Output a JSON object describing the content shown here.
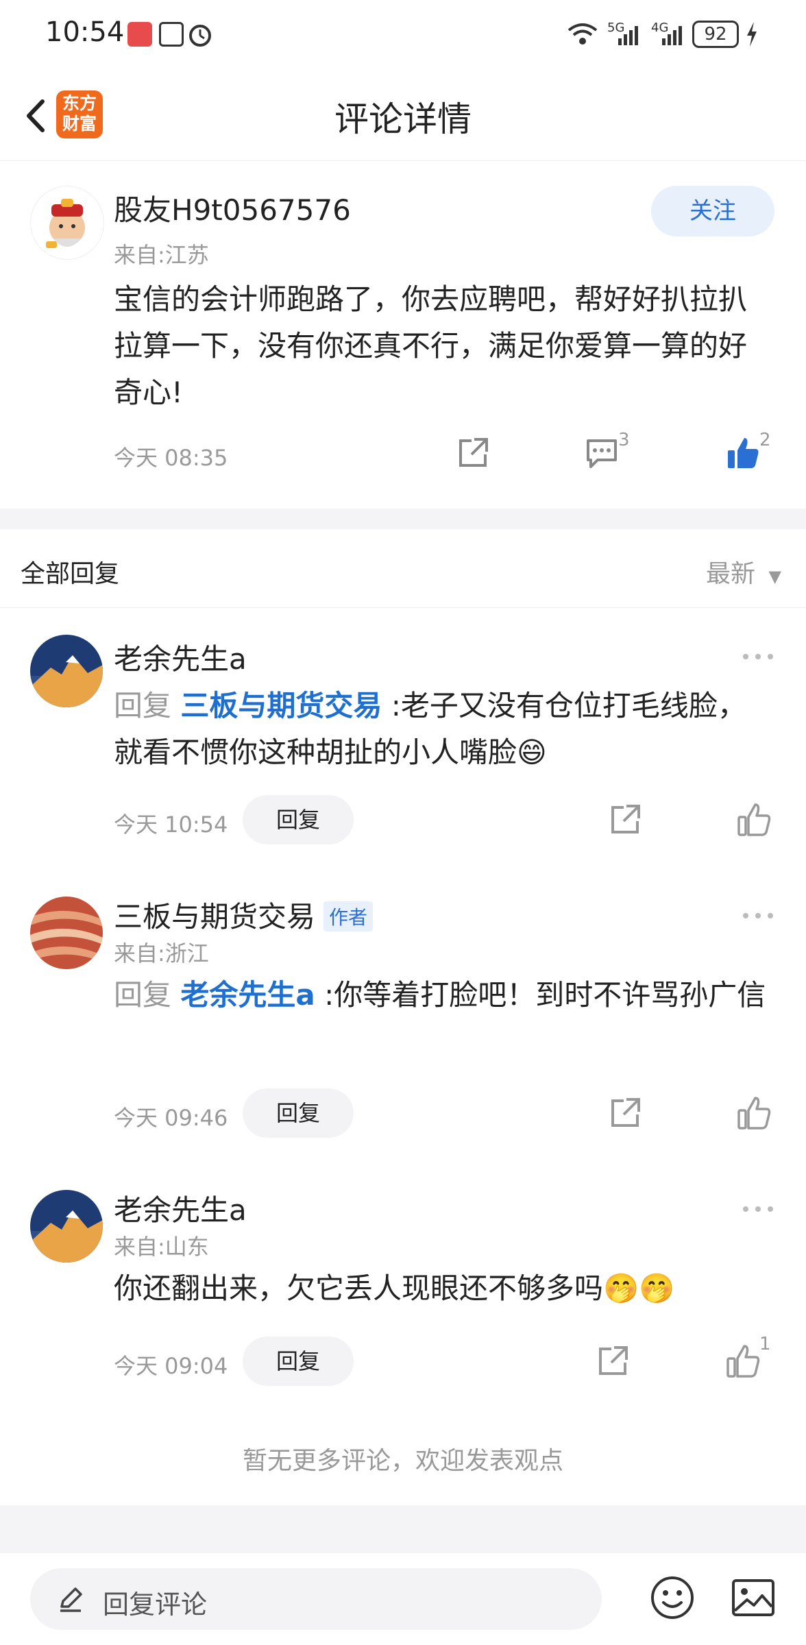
{
  "status_bar": {
    "time": "10:54",
    "battery": "92",
    "signal_labels": [
      "5G",
      "4G"
    ]
  },
  "header": {
    "title": "评论详情",
    "logo_line1": "东方",
    "logo_line2": "财富"
  },
  "main_comment": {
    "username": "股友H9t0567576",
    "location": "来自:江苏",
    "follow_label": "关注",
    "text": "宝信的会计师跑路了，你去应聘吧，帮好好扒拉扒拉算一下，没有你还真不行，满足你爱算一算的好奇心!",
    "time": "今天 08:35",
    "comment_count": "3",
    "like_count": "2"
  },
  "replies_section": {
    "label": "全部回复",
    "sort": "最新",
    "reply_button_label": "回复",
    "reply_prefix": "回复",
    "items": [
      {
        "username": "老余先生a",
        "location": "",
        "target": "三板与期货交易",
        "text": ":老子又没有仓位打毛线脸，就看不惯你这种胡扯的小人嘴脸😄",
        "time": "今天 10:54",
        "like_count": ""
      },
      {
        "username": "三板与期货交易",
        "badge": "作者",
        "location": "来自:浙江",
        "target": "老余先生a",
        "text": ":你等着打脸吧！到时不许骂孙广信",
        "time": "今天 09:46",
        "like_count": ""
      },
      {
        "username": "老余先生a",
        "location": "来自:山东",
        "target": "",
        "text": "你还翻出来，欠它丢人现眼还不够多吗🤭🤭",
        "time": "今天 09:04",
        "like_count": "1"
      }
    ],
    "no_more": "暂无更多评论，欢迎发表观点"
  },
  "bottom_bar": {
    "input_placeholder": "回复评论"
  },
  "colors": {
    "accent_blue": "#1e6fd0",
    "logo_orange": "#f06a1e",
    "muted_gray": "#999999"
  }
}
